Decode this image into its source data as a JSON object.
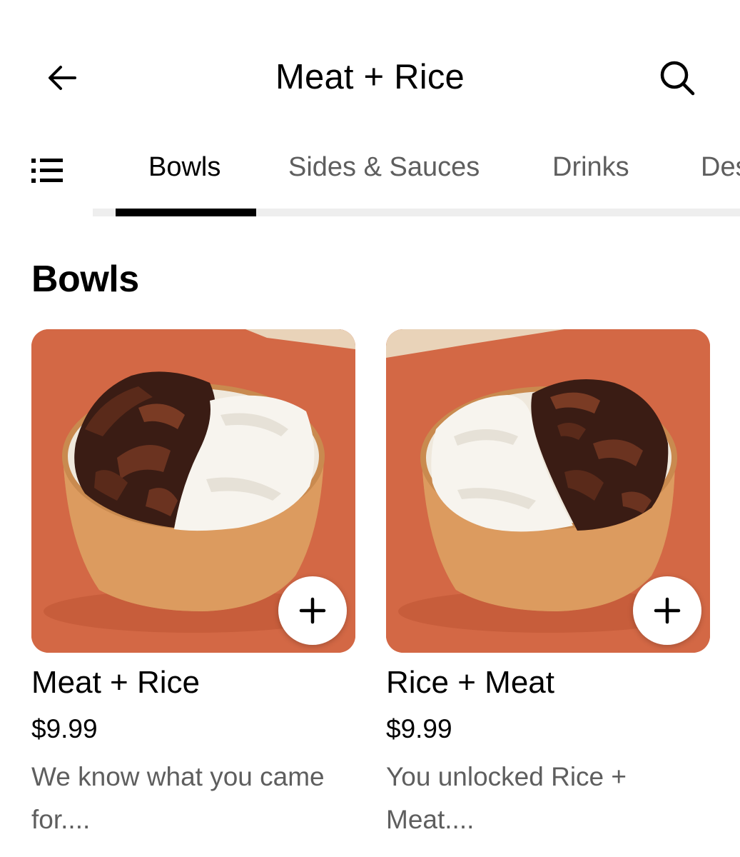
{
  "header": {
    "title": "Meat + Rice",
    "back_icon": "arrow-left-icon",
    "search_icon": "search-icon"
  },
  "tabs": {
    "menu_icon": "list-icon",
    "items": [
      {
        "label": "Bowls",
        "active": true
      },
      {
        "label": "Sides & Sauces",
        "active": false
      },
      {
        "label": "Drinks",
        "active": false
      },
      {
        "label": "Desserts",
        "active": false
      }
    ]
  },
  "section": {
    "title": "Bowls"
  },
  "items": [
    {
      "name": "Meat + Rice",
      "price": "$9.99",
      "description": "We know what you came for...."
    },
    {
      "name": "Rice + Meat",
      "price": "$9.99",
      "description": "You unlocked Rice + Meat...."
    }
  ],
  "colors": {
    "text_primary": "#000000",
    "text_secondary": "#5e5e5e",
    "tab_track": "#eeeeee",
    "image_background": "#d36845",
    "bowl": "#e0a36a",
    "rice": "#f7f4ee",
    "meat": "#3a1c14"
  }
}
